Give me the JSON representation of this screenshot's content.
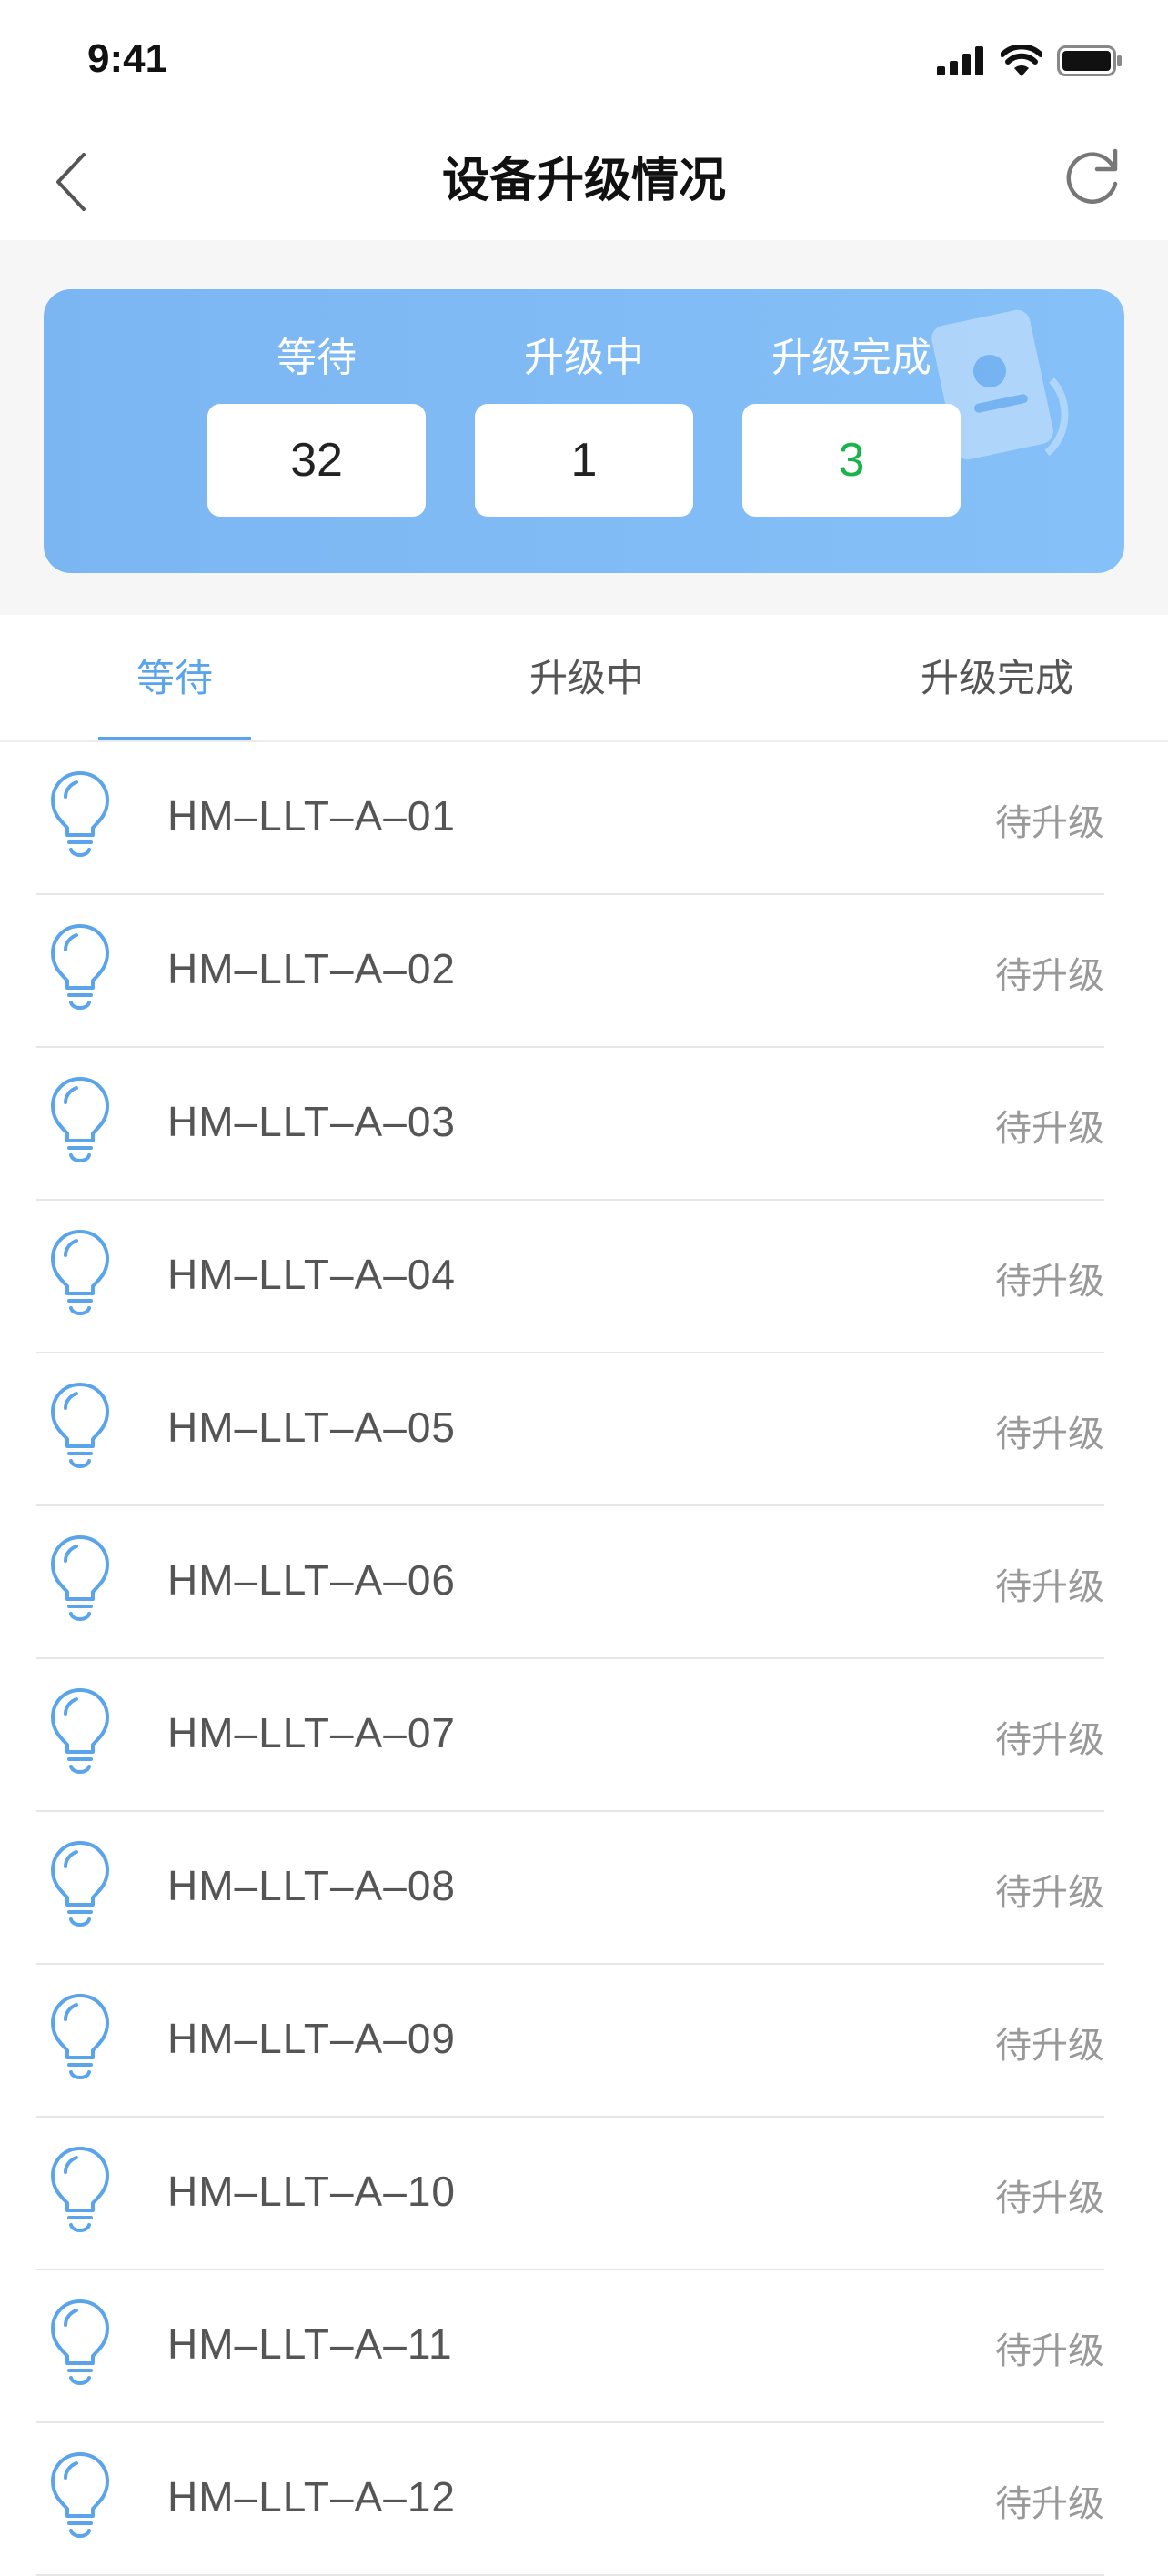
{
  "status_bar": {
    "time": "9:41"
  },
  "header": {
    "title": "设备升级情况",
    "back_icon": "chevron-left-icon",
    "refresh_icon": "refresh-icon"
  },
  "summary": {
    "items": [
      {
        "label": "等待",
        "value": "32"
      },
      {
        "label": "升级中",
        "value": "1"
      },
      {
        "label": "升级完成",
        "value": "3"
      }
    ],
    "card_color": "#7bb6f3",
    "completed_color": "#19b34b"
  },
  "tabs": {
    "items": [
      {
        "label": "等待"
      },
      {
        "label": "升级中"
      },
      {
        "label": "升级完成"
      }
    ],
    "active": "等待",
    "accent": "#5aa4ec"
  },
  "devices": [
    {
      "name": "HM–LLT–A–01",
      "status": "待升级"
    },
    {
      "name": "HM–LLT–A–02",
      "status": "待升级"
    },
    {
      "name": "HM–LLT–A–03",
      "status": "待升级"
    },
    {
      "name": "HM–LLT–A–04",
      "status": "待升级"
    },
    {
      "name": "HM–LLT–A–05",
      "status": "待升级"
    },
    {
      "name": "HM–LLT–A–06",
      "status": "待升级"
    },
    {
      "name": "HM–LLT–A–07",
      "status": "待升级"
    },
    {
      "name": "HM–LLT–A–08",
      "status": "待升级"
    },
    {
      "name": "HM–LLT–A–09",
      "status": "待升级"
    },
    {
      "name": "HM–LLT–A–10",
      "status": "待升级"
    },
    {
      "name": "HM–LLT–A–11",
      "status": "待升级"
    },
    {
      "name": "HM–LLT–A–12",
      "status": "待升级"
    }
  ]
}
